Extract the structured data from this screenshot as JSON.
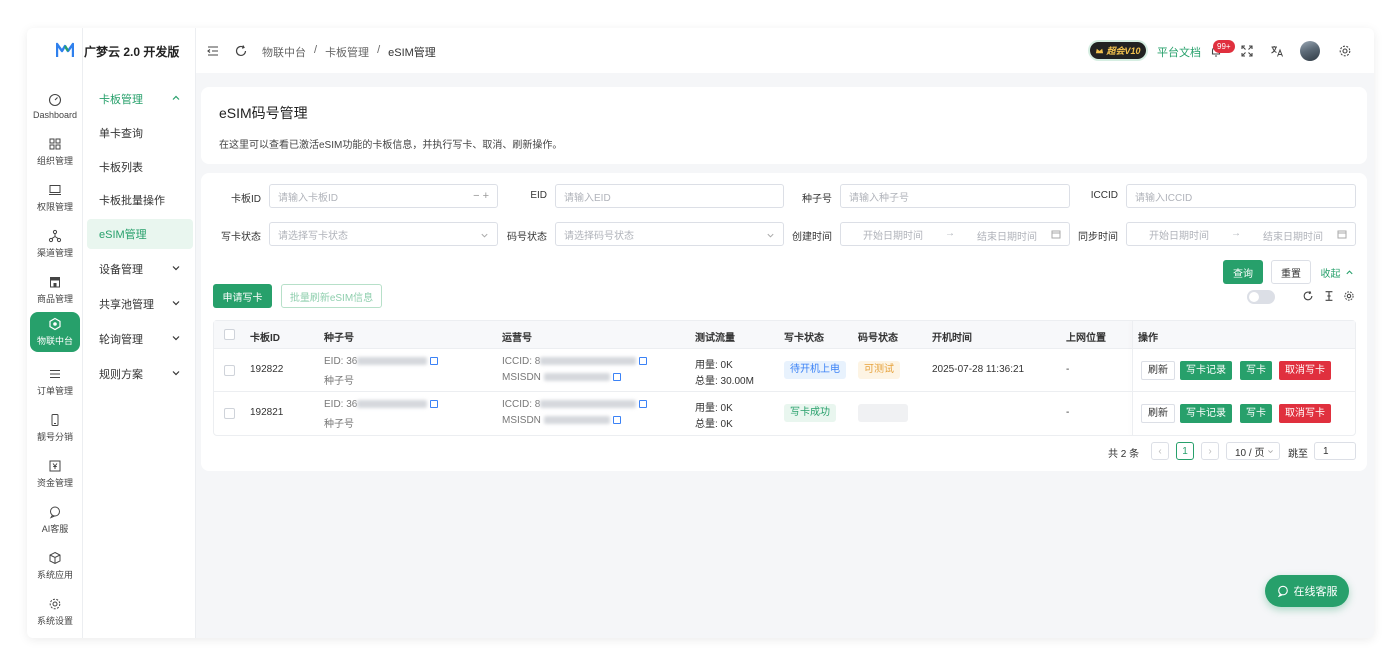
{
  "app": {
    "brand": "广梦云 2.0 开发版"
  },
  "rail": [
    {
      "label": "Dashboard",
      "icon": "gauge-icon"
    },
    {
      "label": "组织管理",
      "icon": "grid-icon"
    },
    {
      "label": "权限管理",
      "icon": "monitor-icon"
    },
    {
      "label": "渠道管理",
      "icon": "network-icon"
    },
    {
      "label": "商品管理",
      "icon": "store-icon"
    },
    {
      "label": "物联中台",
      "icon": "iot-icon",
      "active": true
    },
    {
      "label": "订单管理",
      "icon": "list-icon"
    },
    {
      "label": "靓号分销",
      "icon": "phone-icon"
    },
    {
      "label": "资金管理",
      "icon": "yen-icon"
    },
    {
      "label": "AI客服",
      "icon": "ai-chat-icon"
    },
    {
      "label": "系统应用",
      "icon": "cube-icon"
    },
    {
      "label": "系统设置",
      "icon": "gear-icon"
    }
  ],
  "submenu": {
    "group": "卡板管理",
    "items": [
      "单卡查询",
      "卡板列表",
      "卡板批量操作",
      "eSIM管理"
    ],
    "active": "eSIM管理",
    "collapsed_groups": [
      "设备管理",
      "共享池管理",
      "轮询管理",
      "规则方案"
    ]
  },
  "breadcrumb": [
    "物联中台",
    "卡板管理",
    "eSIM管理"
  ],
  "header": {
    "vip_label": "超会V10",
    "docs_label": "平台文档",
    "notify_badge": "99+"
  },
  "page": {
    "title": "eSIM码号管理",
    "description": "在这里可以查看已激活eSIM功能的卡板信息，并执行写卡、取消、刷新操作。"
  },
  "filters": {
    "board_id": {
      "label": "卡板ID",
      "placeholder": "请输入卡板ID"
    },
    "eid": {
      "label": "EID",
      "placeholder": "请输入EID"
    },
    "seed": {
      "label": "种子号",
      "placeholder": "请输入种子号"
    },
    "iccid": {
      "label": "ICCID",
      "placeholder": "请输入ICCID"
    },
    "write_status": {
      "label": "写卡状态",
      "placeholder": "请选择写卡状态"
    },
    "number_status": {
      "label": "码号状态",
      "placeholder": "请选择码号状态"
    },
    "create_time": {
      "label": "创建时间",
      "start": "开始日期时间",
      "end": "结束日期时间"
    },
    "sync_time": {
      "label": "同步时间",
      "start": "开始日期时间",
      "end": "结束日期时间"
    },
    "query_label": "查询",
    "reset_label": "重置",
    "collapse_label": "收起"
  },
  "toolbar": {
    "apply_label": "申请写卡",
    "batch_refresh_label": "批量刷新eSIM信息"
  },
  "table": {
    "columns": [
      "卡板ID",
      "种子号",
      "运营号",
      "测试流量",
      "写卡状态",
      "码号状态",
      "开机时间",
      "上网位置",
      "操作"
    ],
    "rows": [
      {
        "board_id": "192822",
        "eid_prefix": "EID: 36",
        "seed_label": "种子号",
        "iccid_prefix": "ICCID: 8",
        "msisdn_label": "MSISDN",
        "used": "用量: 0K",
        "total": "总量: 30.00M",
        "write_status": "待开机上电",
        "write_color": "blue",
        "number_status": "可测试",
        "boot_time": "2025-07-28 11:36:21",
        "location": "-",
        "actions": [
          "刷新",
          "写卡记录",
          "写卡",
          "取消写卡"
        ]
      },
      {
        "board_id": "192821",
        "eid_prefix": "EID: 36",
        "seed_label": "种子号",
        "iccid_prefix": "ICCID: 8",
        "msisdn_label": "MSISDN",
        "used": "用量: 0K",
        "total": "总量: 0K",
        "write_status": "写卡成功",
        "write_color": "green",
        "number_status": "",
        "boot_time": "",
        "location": "-",
        "actions": [
          "刷新",
          "写卡记录",
          "写卡",
          "取消写卡"
        ]
      }
    ]
  },
  "pagination": {
    "total": "共 2 条",
    "current": "1",
    "page_size": "10 / 页",
    "jump_label": "跳至",
    "jump_value": "1"
  },
  "chat_label": "在线客服",
  "colors": {
    "accent": "#27a06b",
    "danger": "#e0303e",
    "info": "#3b82f6",
    "warning": "#e6a23c"
  }
}
